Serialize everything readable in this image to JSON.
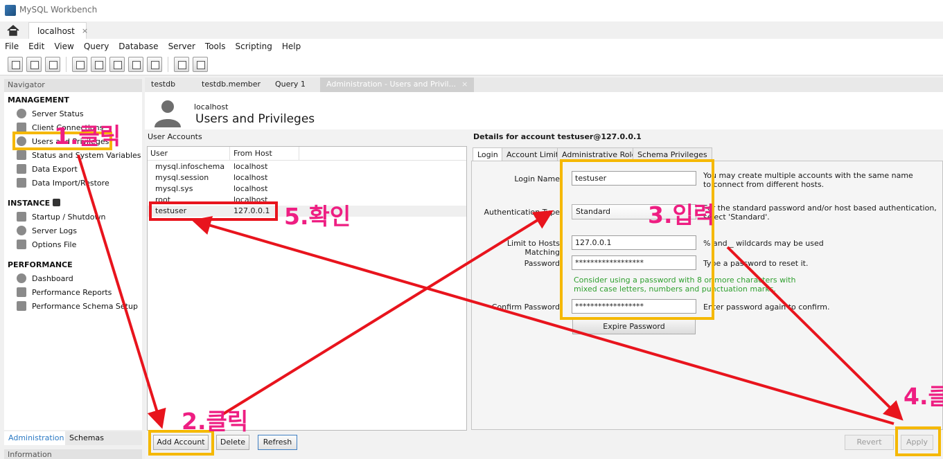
{
  "window": {
    "title": "MySQL Workbench"
  },
  "connection_tab": {
    "label": "localhost",
    "close": "×"
  },
  "menu": [
    "File",
    "Edit",
    "View",
    "Query",
    "Database",
    "Server",
    "Tools",
    "Scripting",
    "Help"
  ],
  "navigator": {
    "header": "Navigator",
    "management": {
      "title": "MANAGEMENT",
      "items": [
        "Server Status",
        "Client Connections",
        "Users and Privileges",
        "Status and System Variables",
        "Data Export",
        "Data Import/Restore"
      ]
    },
    "instance": {
      "title": "INSTANCE",
      "items": [
        "Startup / Shutdown",
        "Server Logs",
        "Options File"
      ]
    },
    "performance": {
      "title": "PERFORMANCE",
      "items": [
        "Dashboard",
        "Performance Reports",
        "Performance Schema Setup"
      ]
    },
    "tabs": [
      "Administration",
      "Schemas"
    ],
    "info_header": "Information"
  },
  "doc_tabs": [
    "testdb",
    "testdb.member",
    "Query 1",
    "Administration - Users and Privil..."
  ],
  "users_page": {
    "host": "localhost",
    "title": "Users and Privileges",
    "accounts_label": "User Accounts",
    "columns": [
      "User",
      "From Host"
    ],
    "rows": [
      {
        "user": "mysql.infoschema",
        "host": "localhost"
      },
      {
        "user": "mysql.session",
        "host": "localhost"
      },
      {
        "user": "mysql.sys",
        "host": "localhost"
      },
      {
        "user": "root",
        "host": "localhost"
      },
      {
        "user": "testuser",
        "host": "127.0.0.1"
      }
    ]
  },
  "details": {
    "title": "Details for account testuser@127.0.0.1",
    "tabs": [
      "Login",
      "Account Limits",
      "Administrative Roles",
      "Schema Privileges"
    ],
    "login_name": {
      "label": "Login Name",
      "value": "testuser",
      "desc1": "You may create multiple accounts with the same name",
      "desc2": "to connect from different hosts."
    },
    "auth_type": {
      "label": "Authentication Type",
      "value": "Standard",
      "desc1": "For the standard password and/or host based authentication,",
      "desc2": "select 'Standard'."
    },
    "host_match": {
      "label": "Limit to Hosts Matching",
      "value": "127.0.0.1",
      "desc": "% and _ wildcards may be used"
    },
    "password": {
      "label": "Password",
      "value": "******************",
      "desc": "Type a password to reset it."
    },
    "pw_hint1": "Consider using a password with 8 or more characters with",
    "pw_hint2": "mixed case letters, numbers and punctuation marks.",
    "confirm": {
      "label": "Confirm Password",
      "value": "******************",
      "desc": "Enter password again to confirm."
    },
    "expire_button": "Expire Password"
  },
  "buttons": {
    "add": "Add Account",
    "delete": "Delete",
    "refresh": "Refresh",
    "revert": "Revert",
    "apply": "Apply"
  },
  "annotations": {
    "step1": "1.클릭",
    "step2": "2.클릭",
    "step3": "3.입력",
    "step4": "4.클",
    "step5": "5.확인",
    "highlight_color": "#f5b800",
    "arrow_color": "#e8141d",
    "text_color": "#ee1e82"
  }
}
